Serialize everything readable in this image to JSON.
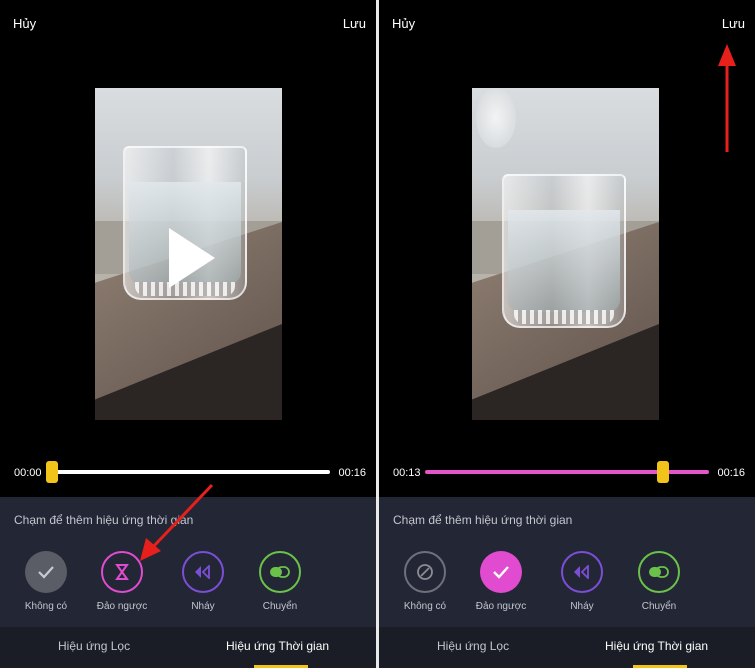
{
  "left_screen": {
    "header": {
      "cancel_label": "Hủy",
      "save_label": "Lưu"
    },
    "timeline": {
      "start_time": "00:00",
      "end_time": "00:16",
      "position": 0
    },
    "effects_hint": "Chạm để thêm hiệu ứng thời gian",
    "effects": [
      {
        "label": "Không có",
        "icon": "check-icon",
        "selected": false
      },
      {
        "label": "Đảo ngược",
        "icon": "hourglass-icon",
        "selected": false
      },
      {
        "label": "Nháy",
        "icon": "flash-icon",
        "selected": false
      },
      {
        "label": "Chuyển",
        "icon": "transition-icon",
        "selected": false
      }
    ],
    "tabs": {
      "filter_label": "Hiệu ứng Lọc",
      "time_label": "Hiệu ứng Thời gian",
      "active": "time"
    }
  },
  "right_screen": {
    "header": {
      "cancel_label": "Hủy",
      "save_label": "Lưu"
    },
    "timeline": {
      "start_time": "00:13",
      "end_time": "00:16",
      "position": 0.82
    },
    "effects_hint": "Chạm để thêm hiệu ứng thời gian",
    "effects": [
      {
        "label": "Không có",
        "icon": "none-icon",
        "selected": false
      },
      {
        "label": "Đảo ngược",
        "icon": "check-icon",
        "selected": true
      },
      {
        "label": "Nháy",
        "icon": "flash-icon",
        "selected": false
      },
      {
        "label": "Chuyển",
        "icon": "transition-icon",
        "selected": false
      }
    ],
    "tabs": {
      "filter_label": "Hiệu ứng Lọc",
      "time_label": "Hiệu ứng Thời gian",
      "active": "time"
    }
  },
  "colors": {
    "accent_pink": "#e04bd0",
    "scrubber_yellow": "#f2c318",
    "flash_purple": "#7a4fd6",
    "transition_green": "#6ac24a",
    "annotation_red": "#e8201c",
    "sheet_background": "#232634"
  }
}
